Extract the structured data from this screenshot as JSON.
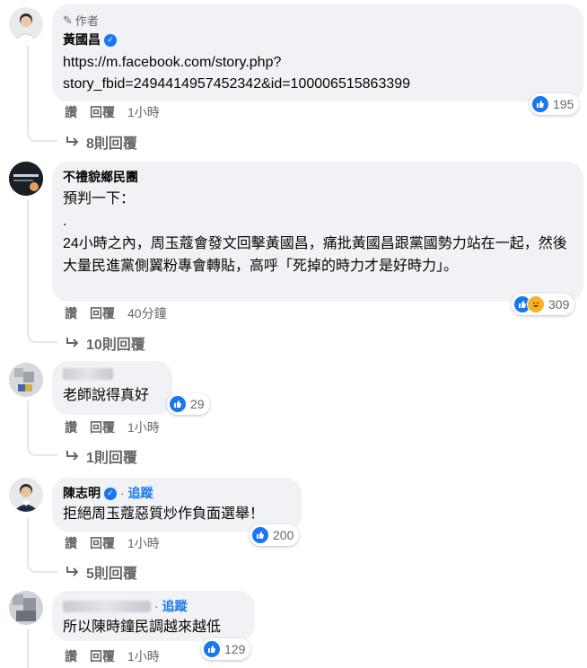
{
  "comments": [
    {
      "author_badge": "作者",
      "author": "黃國昌",
      "verified": true,
      "text": "https://m.facebook.com/story.php?\nstory_fbid=2494414957452342&id=100006515863399",
      "reaction_count": "195",
      "actions": {
        "like": "讚",
        "reply": "回覆",
        "time": "1小時"
      },
      "replies": "8則回覆"
    },
    {
      "author": "不禮貌鄉民團",
      "text": "預判一下：\n.\n24小時之內，周玉蔻會發文回擊黃國昌，痛批黃國昌跟黨國勢力站在一起，然後大量民進黨側翼粉專會轉貼，高呼「死掉的時力才是好時力」。",
      "reaction_count": "309",
      "actions": {
        "like": "讚",
        "reply": "回覆",
        "time": "40分鐘"
      },
      "replies": "10則回覆"
    },
    {
      "author": "",
      "text": "老師說得真好",
      "reaction_count": "29",
      "actions": {
        "like": "讚",
        "reply": "回覆",
        "time": "1小時"
      },
      "replies": "1則回覆"
    },
    {
      "author": "陳志明",
      "verified": true,
      "follow": "追蹤",
      "text": "拒絕周玉蔻惡質炒作負面選舉！",
      "reaction_count": "200",
      "actions": {
        "like": "讚",
        "reply": "回覆",
        "time": "1小時"
      },
      "replies": "5則回覆"
    },
    {
      "author": "",
      "follow": "追蹤",
      "text": "所以陳時鐘民調越來越低",
      "reaction_count": "129",
      "actions": {
        "like": "讚",
        "reply": "回覆",
        "time": "1小時"
      }
    }
  ],
  "colors": {
    "accent": "#1877f2",
    "bubble": "#f0f2f5",
    "muted": "#65676b"
  },
  "icons": {
    "author_badge": "pencil-icon",
    "verified": "check-badge-icon",
    "like": "thumbs-up-icon",
    "haha": "laughing-face-icon",
    "reply": "reply-arrow-icon"
  }
}
